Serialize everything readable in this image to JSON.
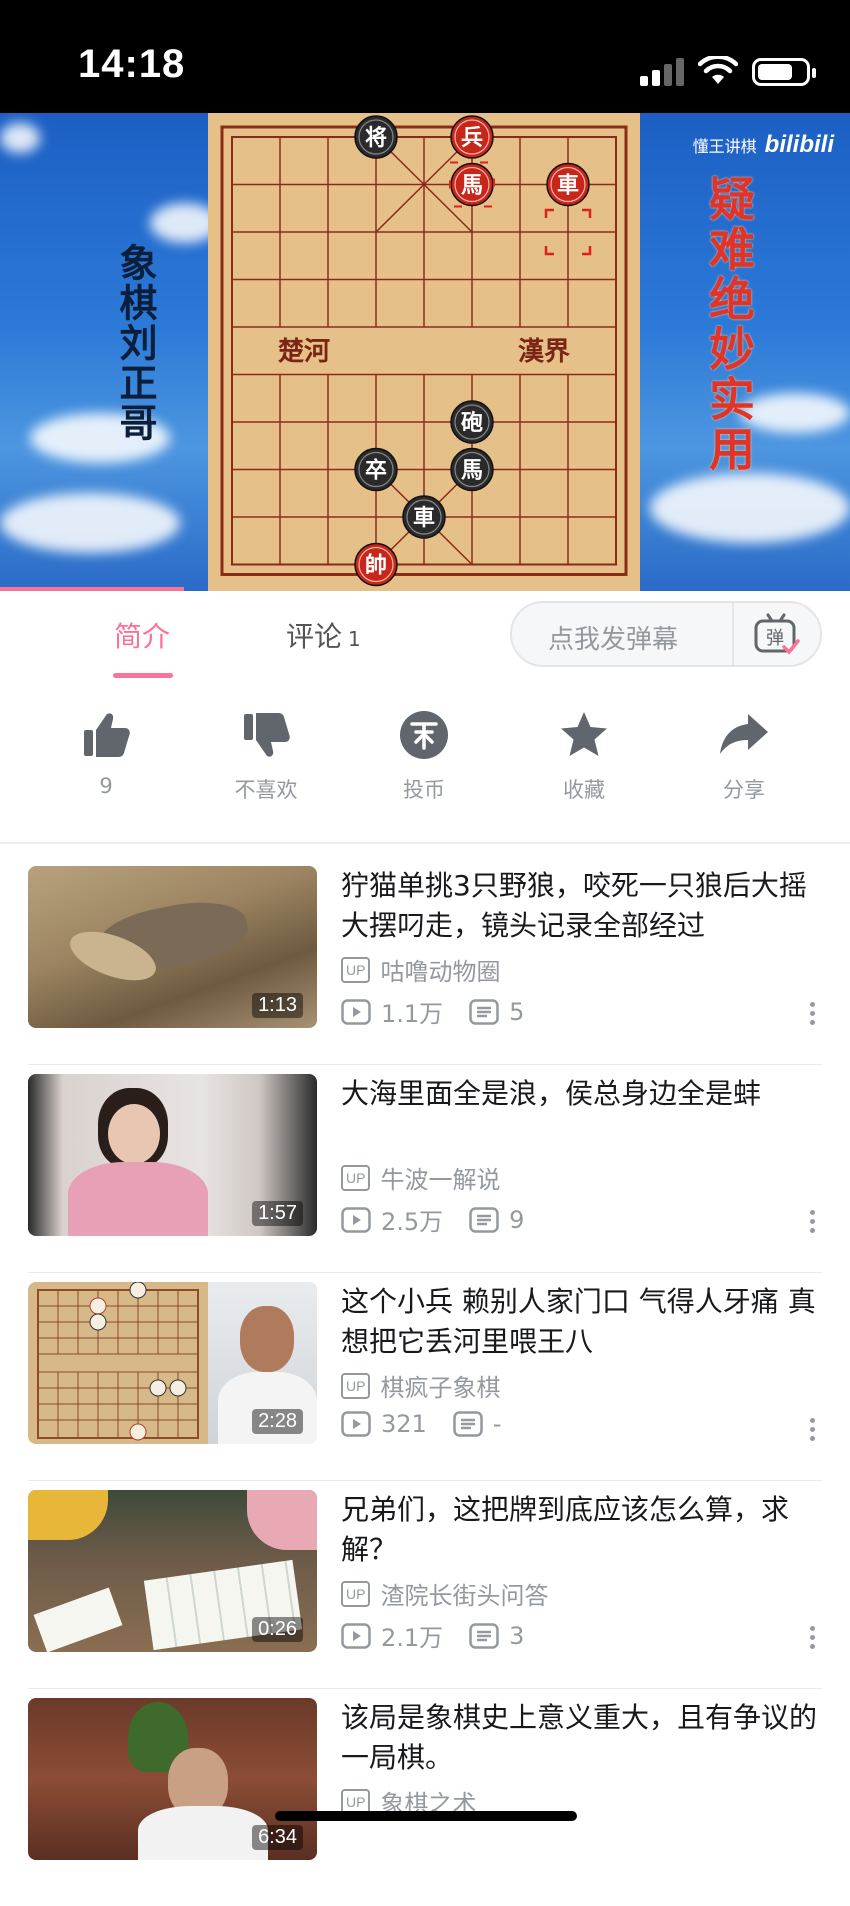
{
  "status_bar": {
    "time": "14:18"
  },
  "video": {
    "left_caption": "象棋刘正哥",
    "right_caption": "疑难绝妙实用",
    "watermark_text": "懂王讲棋",
    "watermark_logo": "bilibili",
    "board_river_left": "楚河",
    "board_river_right": "漢界",
    "pieces": [
      {
        "text": "将",
        "color": "black"
      },
      {
        "text": "兵",
        "color": "red"
      },
      {
        "text": "馬",
        "color": "red"
      },
      {
        "text": "車",
        "color": "red"
      },
      {
        "text": "砲",
        "color": "black"
      },
      {
        "text": "卒",
        "color": "black"
      },
      {
        "text": "馬",
        "color": "black"
      },
      {
        "text": "車",
        "color": "black"
      },
      {
        "text": "帥",
        "color": "red"
      }
    ]
  },
  "tabs": {
    "intro_label": "简介",
    "comments_label": "评论",
    "comments_count": "1",
    "danmaku_placeholder": "点我发弹幕",
    "danmaku_icon_text": "弹"
  },
  "actions": [
    {
      "icon": "thumbs-up-icon",
      "label": "9"
    },
    {
      "icon": "thumbs-down-icon",
      "label": "不喜欢"
    },
    {
      "icon": "coin-icon",
      "label": "投币"
    },
    {
      "icon": "star-icon",
      "label": "收藏"
    },
    {
      "icon": "share-icon",
      "label": "分享"
    }
  ],
  "feed": [
    {
      "title": "狞猫单挑3只野狼，咬死一只狼后大摇大摆叼走，镜头记录全部经过",
      "up": "咕噜动物圈",
      "views": "1.1万",
      "danmaku": "5",
      "duration": "1:13"
    },
    {
      "title": "大海里面全是浪，侯总身边全是蚌",
      "up": "牛波一解说",
      "views": "2.5万",
      "danmaku": "9",
      "duration": "1:57"
    },
    {
      "title": "这个小兵  赖别人家门口  气得人牙痛  真想把它丢河里喂王八",
      "up": "棋疯子象棋",
      "views": "321",
      "danmaku": "-",
      "duration": "2:28"
    },
    {
      "title": "兄弟们，这把牌到底应该怎么算，求解？",
      "up": "渣院长街头问答",
      "views": "2.1万",
      "danmaku": "3",
      "duration": "0:26"
    },
    {
      "title": "该局是象棋史上意义重大，且有争议的一局棋。",
      "up": "象棋之术",
      "views": "",
      "danmaku": "",
      "duration": "6:34"
    }
  ],
  "up_badge": "UP",
  "colors": {
    "accent": "#fb7299",
    "muted": "#9499a0",
    "sky": "#2c7ad8",
    "board": "#e6c089"
  }
}
